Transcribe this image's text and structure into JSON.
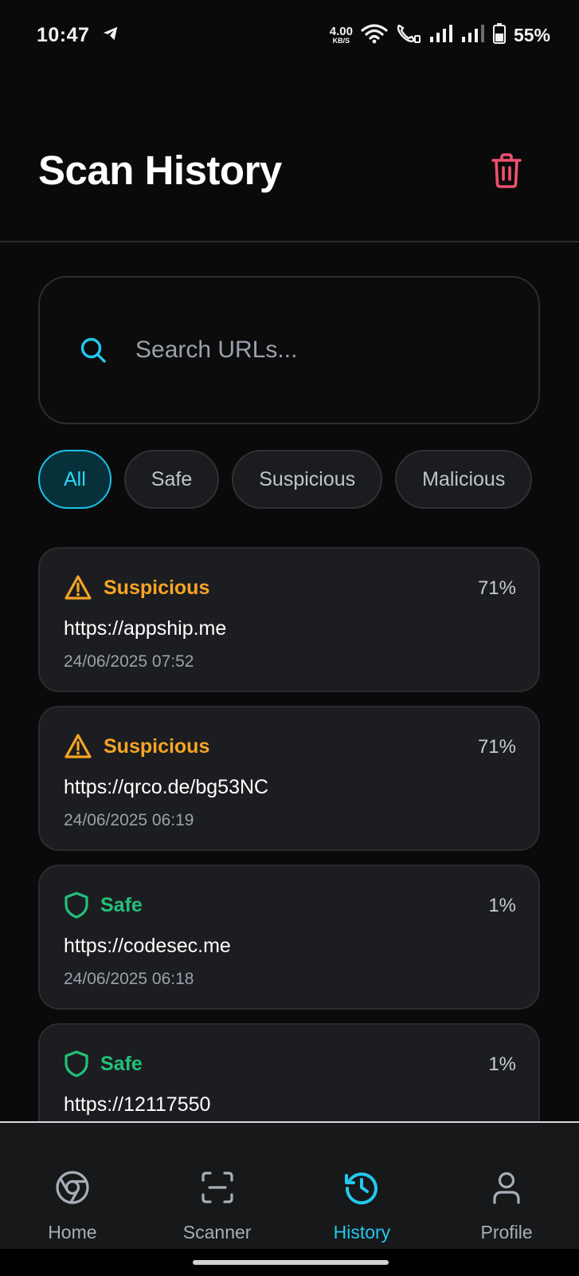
{
  "status_bar": {
    "time": "10:47",
    "net_speed_value": "4.00",
    "net_speed_unit": "KB/S",
    "battery": "55%",
    "icons": [
      "telegram-icon",
      "wifi-icon",
      "volte-call-icon",
      "signal-icon",
      "signal-icon",
      "battery-icon"
    ]
  },
  "header": {
    "title": "Scan History",
    "delete_icon": "trash-icon"
  },
  "search": {
    "placeholder": "Search URLs...",
    "value": "",
    "icon": "search-icon"
  },
  "filters": {
    "active": "All",
    "items": [
      {
        "label": "All"
      },
      {
        "label": "Safe"
      },
      {
        "label": "Suspicious"
      },
      {
        "label": "Malicious"
      }
    ]
  },
  "history": [
    {
      "status": "Suspicious",
      "icon": "warning-icon",
      "color": "#f5a524",
      "percent": "71%",
      "url": "https://appship.me",
      "date": "24/06/2025 07:52"
    },
    {
      "status": "Suspicious",
      "icon": "warning-icon",
      "color": "#f5a524",
      "percent": "71%",
      "url": "https://qrco.de/bg53NC",
      "date": "24/06/2025 06:19"
    },
    {
      "status": "Safe",
      "icon": "shield-icon",
      "color": "#22c07a",
      "percent": "1%",
      "url": "https://codesec.me",
      "date": "24/06/2025 06:18"
    },
    {
      "status": "Safe",
      "icon": "shield-icon",
      "color": "#22c07a",
      "percent": "1%",
      "url": "https://12117550",
      "date": ""
    }
  ],
  "bottom_nav": {
    "active": "History",
    "items": [
      {
        "label": "Home",
        "icon": "chrome-icon"
      },
      {
        "label": "Scanner",
        "icon": "scan-frame-icon"
      },
      {
        "label": "History",
        "icon": "history-icon"
      },
      {
        "label": "Profile",
        "icon": "user-icon"
      }
    ]
  },
  "colors": {
    "accent": "#22c9ec",
    "suspicious": "#f5a524",
    "safe": "#22c07a",
    "danger": "#f0506e",
    "background": "#0a0a0b",
    "card": "#1c1d20"
  }
}
